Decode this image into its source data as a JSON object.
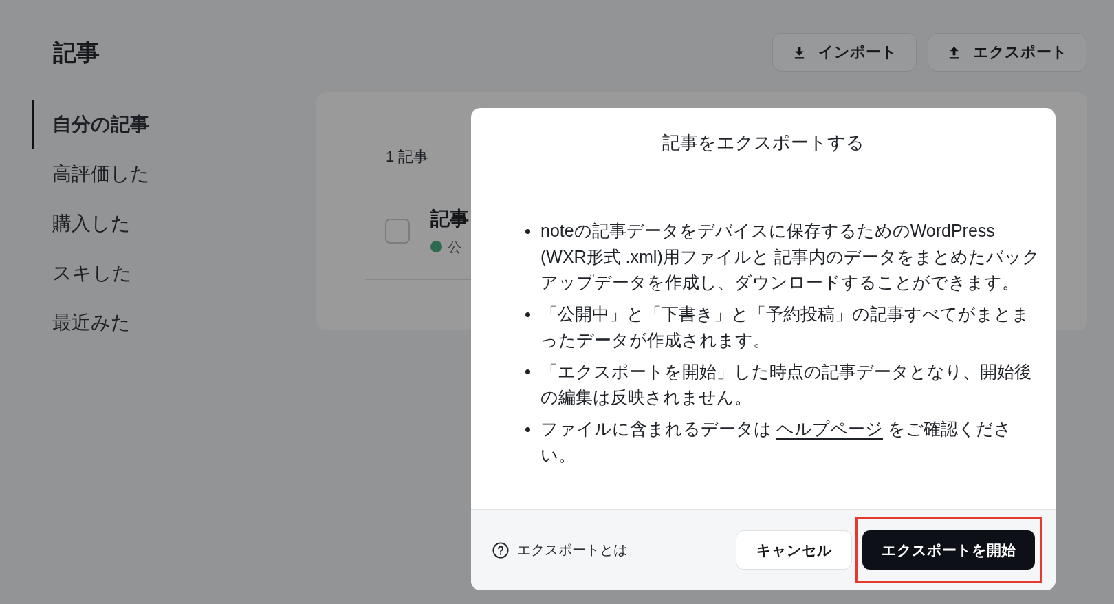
{
  "page": {
    "title": "記事"
  },
  "toolbar": {
    "buttons": [
      {
        "label": "インポート",
        "kind": "import"
      },
      {
        "label": "エクスポート",
        "kind": "export"
      }
    ]
  },
  "sidebar": {
    "items": [
      {
        "label": "自分の記事",
        "selected": true
      },
      {
        "label": "高評価した",
        "selected": false
      },
      {
        "label": "購入した",
        "selected": false
      },
      {
        "label": "スキした",
        "selected": false
      },
      {
        "label": "最近みた",
        "selected": false
      }
    ]
  },
  "article_list": {
    "count": "1 記事",
    "items": [
      {
        "title": "記事",
        "status": "公",
        "checked": false,
        "color": "#2d6a4f"
      }
    ]
  },
  "dialog": {
    "title": "記事をエクスポートする",
    "bullets": [
      {
        "text": "noteの記事データをデバイスに保存するためのWordPress (WXR形式 .xml)用ファイルと 記事内のデータをまとめたバックアップデータを作成し、ダウンロードすることができます。"
      },
      {
        "text": "「公開中」と「下書き」と「予約投稿」の記事すべてがまとまったデータが作成されます。"
      },
      {
        "text": "「エクスポートを開始」した時点の記事データとなり、開始後の編集は反映されません。"
      },
      {
        "text": "ファイルに含まれるデータは",
        "link": "ヘルプページ",
        "text_after": "をご確認ください。"
      }
    ],
    "help": "エクスポートとは",
    "buttons": [
      {
        "label": "キャンセル",
        "kind": "secondary"
      },
      {
        "label": "エクスポートを開始",
        "kind": "primary",
        "highlighted": true
      }
    ]
  }
}
